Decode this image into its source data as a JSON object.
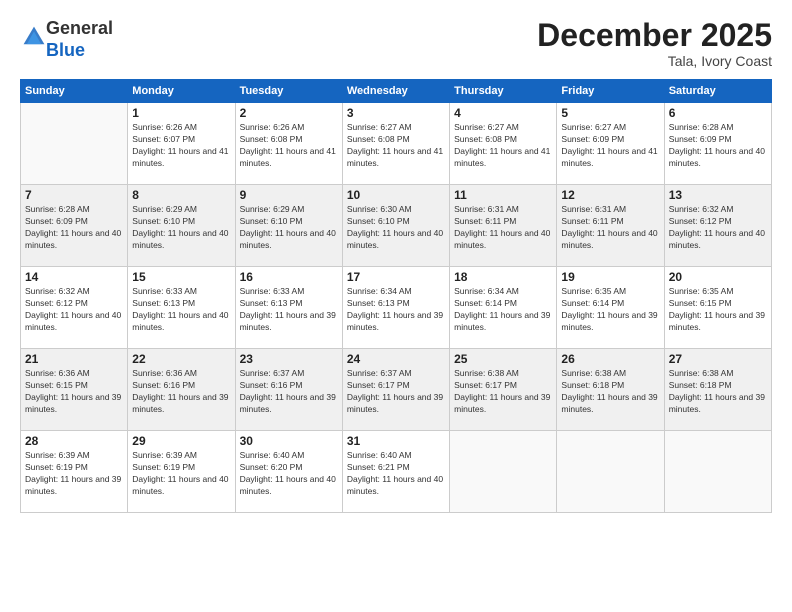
{
  "logo": {
    "general": "General",
    "blue": "Blue"
  },
  "header": {
    "month": "December 2025",
    "location": "Tala, Ivory Coast"
  },
  "weekdays": [
    "Sunday",
    "Monday",
    "Tuesday",
    "Wednesday",
    "Thursday",
    "Friday",
    "Saturday"
  ],
  "weeks": [
    [
      {
        "day": "",
        "sunrise": "",
        "sunset": "",
        "daylight": ""
      },
      {
        "day": "1",
        "sunrise": "Sunrise: 6:26 AM",
        "sunset": "Sunset: 6:07 PM",
        "daylight": "Daylight: 11 hours and 41 minutes."
      },
      {
        "day": "2",
        "sunrise": "Sunrise: 6:26 AM",
        "sunset": "Sunset: 6:08 PM",
        "daylight": "Daylight: 11 hours and 41 minutes."
      },
      {
        "day": "3",
        "sunrise": "Sunrise: 6:27 AM",
        "sunset": "Sunset: 6:08 PM",
        "daylight": "Daylight: 11 hours and 41 minutes."
      },
      {
        "day": "4",
        "sunrise": "Sunrise: 6:27 AM",
        "sunset": "Sunset: 6:08 PM",
        "daylight": "Daylight: 11 hours and 41 minutes."
      },
      {
        "day": "5",
        "sunrise": "Sunrise: 6:27 AM",
        "sunset": "Sunset: 6:09 PM",
        "daylight": "Daylight: 11 hours and 41 minutes."
      },
      {
        "day": "6",
        "sunrise": "Sunrise: 6:28 AM",
        "sunset": "Sunset: 6:09 PM",
        "daylight": "Daylight: 11 hours and 40 minutes."
      }
    ],
    [
      {
        "day": "7",
        "sunrise": "Sunrise: 6:28 AM",
        "sunset": "Sunset: 6:09 PM",
        "daylight": "Daylight: 11 hours and 40 minutes."
      },
      {
        "day": "8",
        "sunrise": "Sunrise: 6:29 AM",
        "sunset": "Sunset: 6:10 PM",
        "daylight": "Daylight: 11 hours and 40 minutes."
      },
      {
        "day": "9",
        "sunrise": "Sunrise: 6:29 AM",
        "sunset": "Sunset: 6:10 PM",
        "daylight": "Daylight: 11 hours and 40 minutes."
      },
      {
        "day": "10",
        "sunrise": "Sunrise: 6:30 AM",
        "sunset": "Sunset: 6:10 PM",
        "daylight": "Daylight: 11 hours and 40 minutes."
      },
      {
        "day": "11",
        "sunrise": "Sunrise: 6:31 AM",
        "sunset": "Sunset: 6:11 PM",
        "daylight": "Daylight: 11 hours and 40 minutes."
      },
      {
        "day": "12",
        "sunrise": "Sunrise: 6:31 AM",
        "sunset": "Sunset: 6:11 PM",
        "daylight": "Daylight: 11 hours and 40 minutes."
      },
      {
        "day": "13",
        "sunrise": "Sunrise: 6:32 AM",
        "sunset": "Sunset: 6:12 PM",
        "daylight": "Daylight: 11 hours and 40 minutes."
      }
    ],
    [
      {
        "day": "14",
        "sunrise": "Sunrise: 6:32 AM",
        "sunset": "Sunset: 6:12 PM",
        "daylight": "Daylight: 11 hours and 40 minutes."
      },
      {
        "day": "15",
        "sunrise": "Sunrise: 6:33 AM",
        "sunset": "Sunset: 6:13 PM",
        "daylight": "Daylight: 11 hours and 40 minutes."
      },
      {
        "day": "16",
        "sunrise": "Sunrise: 6:33 AM",
        "sunset": "Sunset: 6:13 PM",
        "daylight": "Daylight: 11 hours and 39 minutes."
      },
      {
        "day": "17",
        "sunrise": "Sunrise: 6:34 AM",
        "sunset": "Sunset: 6:13 PM",
        "daylight": "Daylight: 11 hours and 39 minutes."
      },
      {
        "day": "18",
        "sunrise": "Sunrise: 6:34 AM",
        "sunset": "Sunset: 6:14 PM",
        "daylight": "Daylight: 11 hours and 39 minutes."
      },
      {
        "day": "19",
        "sunrise": "Sunrise: 6:35 AM",
        "sunset": "Sunset: 6:14 PM",
        "daylight": "Daylight: 11 hours and 39 minutes."
      },
      {
        "day": "20",
        "sunrise": "Sunrise: 6:35 AM",
        "sunset": "Sunset: 6:15 PM",
        "daylight": "Daylight: 11 hours and 39 minutes."
      }
    ],
    [
      {
        "day": "21",
        "sunrise": "Sunrise: 6:36 AM",
        "sunset": "Sunset: 6:15 PM",
        "daylight": "Daylight: 11 hours and 39 minutes."
      },
      {
        "day": "22",
        "sunrise": "Sunrise: 6:36 AM",
        "sunset": "Sunset: 6:16 PM",
        "daylight": "Daylight: 11 hours and 39 minutes."
      },
      {
        "day": "23",
        "sunrise": "Sunrise: 6:37 AM",
        "sunset": "Sunset: 6:16 PM",
        "daylight": "Daylight: 11 hours and 39 minutes."
      },
      {
        "day": "24",
        "sunrise": "Sunrise: 6:37 AM",
        "sunset": "Sunset: 6:17 PM",
        "daylight": "Daylight: 11 hours and 39 minutes."
      },
      {
        "day": "25",
        "sunrise": "Sunrise: 6:38 AM",
        "sunset": "Sunset: 6:17 PM",
        "daylight": "Daylight: 11 hours and 39 minutes."
      },
      {
        "day": "26",
        "sunrise": "Sunrise: 6:38 AM",
        "sunset": "Sunset: 6:18 PM",
        "daylight": "Daylight: 11 hours and 39 minutes."
      },
      {
        "day": "27",
        "sunrise": "Sunrise: 6:38 AM",
        "sunset": "Sunset: 6:18 PM",
        "daylight": "Daylight: 11 hours and 39 minutes."
      }
    ],
    [
      {
        "day": "28",
        "sunrise": "Sunrise: 6:39 AM",
        "sunset": "Sunset: 6:19 PM",
        "daylight": "Daylight: 11 hours and 39 minutes."
      },
      {
        "day": "29",
        "sunrise": "Sunrise: 6:39 AM",
        "sunset": "Sunset: 6:19 PM",
        "daylight": "Daylight: 11 hours and 40 minutes."
      },
      {
        "day": "30",
        "sunrise": "Sunrise: 6:40 AM",
        "sunset": "Sunset: 6:20 PM",
        "daylight": "Daylight: 11 hours and 40 minutes."
      },
      {
        "day": "31",
        "sunrise": "Sunrise: 6:40 AM",
        "sunset": "Sunset: 6:21 PM",
        "daylight": "Daylight: 11 hours and 40 minutes."
      },
      {
        "day": "",
        "sunrise": "",
        "sunset": "",
        "daylight": ""
      },
      {
        "day": "",
        "sunrise": "",
        "sunset": "",
        "daylight": ""
      },
      {
        "day": "",
        "sunrise": "",
        "sunset": "",
        "daylight": ""
      }
    ]
  ]
}
